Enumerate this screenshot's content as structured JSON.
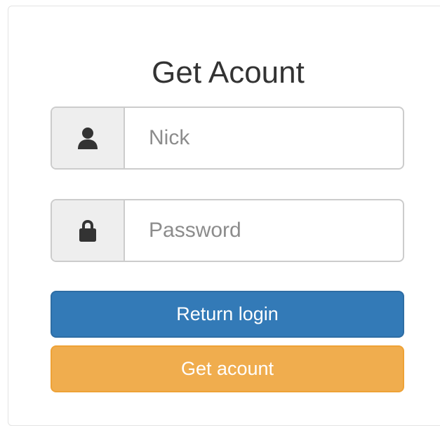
{
  "form": {
    "title": "Get Acount",
    "nick": {
      "icon": "user-icon",
      "placeholder": "Nick",
      "value": ""
    },
    "password": {
      "icon": "lock-icon",
      "placeholder": "Password",
      "value": ""
    },
    "return_button": {
      "label": "Return login",
      "color": "#337ab7"
    },
    "get_button": {
      "label": "Get acount",
      "color": "#f0ad4e"
    }
  },
  "colors": {
    "addon_bg": "#eeeeee",
    "border": "#cccccc",
    "icon": "#333333",
    "title": "#333333"
  }
}
